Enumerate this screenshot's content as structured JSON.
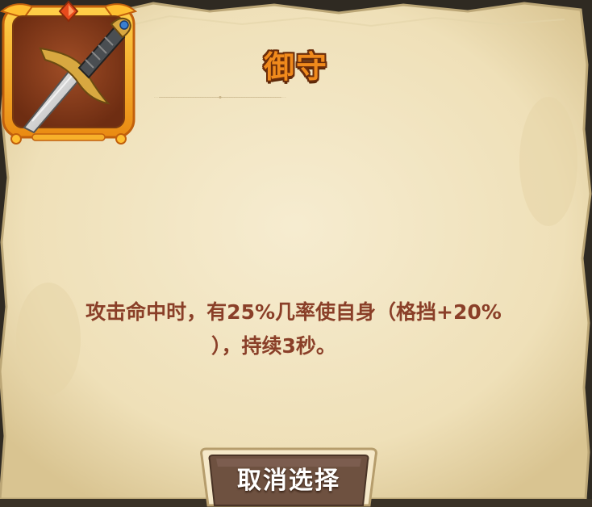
{
  "dialog": {
    "title": "御守",
    "description_line1": "攻击命中时，有25%几率使自身（格挡+20%",
    "description_line2": "），持续3秒。",
    "cancel_label": "取消选择"
  },
  "item": {
    "icon": "dagger-icon"
  },
  "colors": {
    "parchment": "#f2e6c4",
    "parchment_edge": "#d8c69a",
    "title_orange": "#f08a1c",
    "desc_brown": "#8a3f28",
    "frame_gold": "#f2a020",
    "icon_bg": "#8b3e1c",
    "button_brown": "#6e5140"
  }
}
